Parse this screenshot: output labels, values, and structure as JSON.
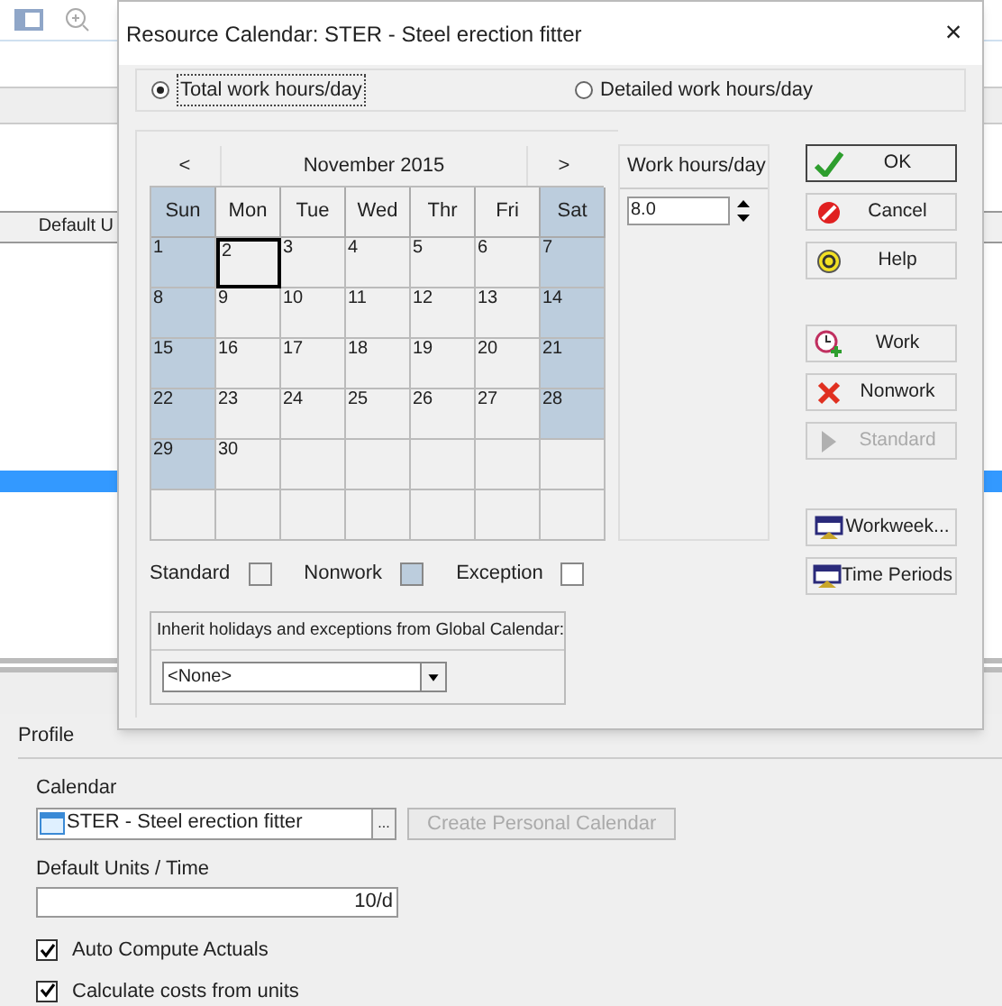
{
  "background": {
    "column_header": "Default U",
    "profile": {
      "title": "Profile",
      "calendar_label": "Calendar",
      "calendar_value": "STER - Steel erection fitter",
      "browse_button": "...",
      "create_button": {
        "label": "Create Personal Calendar",
        "disabled": true
      },
      "units_label": "Default Units / Time",
      "units_value": "10/d",
      "checkboxes": [
        {
          "label": "Auto Compute Actuals",
          "checked": true
        },
        {
          "label": "Calculate costs from units",
          "checked": true
        }
      ]
    }
  },
  "dialog": {
    "title": "Resource Calendar: STER - Steel erection fitter",
    "close": "×",
    "modes": [
      {
        "label": "Total work hours/day",
        "selected": true
      },
      {
        "label": "Detailed work hours/day",
        "selected": false
      }
    ],
    "calendar": {
      "prev": "<",
      "month": "November 2015",
      "next": ">",
      "weekdays": [
        {
          "label": "Sun",
          "nonwork": true
        },
        {
          "label": "Mon",
          "nonwork": false
        },
        {
          "label": "Tue",
          "nonwork": false
        },
        {
          "label": "Wed",
          "nonwork": false
        },
        {
          "label": "Thr",
          "nonwork": false
        },
        {
          "label": "Fri",
          "nonwork": false
        },
        {
          "label": "Sat",
          "nonwork": true
        }
      ],
      "weeks": [
        [
          {
            "day": "1",
            "nonwork": true,
            "selected": false
          },
          {
            "day": "2",
            "nonwork": false,
            "selected": true
          },
          {
            "day": "3",
            "nonwork": false,
            "selected": false
          },
          {
            "day": "4",
            "nonwork": false,
            "selected": false
          },
          {
            "day": "5",
            "nonwork": false,
            "selected": false
          },
          {
            "day": "6",
            "nonwork": false,
            "selected": false
          },
          {
            "day": "7",
            "nonwork": true,
            "selected": false
          }
        ],
        [
          {
            "day": "8",
            "nonwork": true,
            "selected": false
          },
          {
            "day": "9",
            "nonwork": false,
            "selected": false
          },
          {
            "day": "10",
            "nonwork": false,
            "selected": false
          },
          {
            "day": "11",
            "nonwork": false,
            "selected": false
          },
          {
            "day": "12",
            "nonwork": false,
            "selected": false
          },
          {
            "day": "13",
            "nonwork": false,
            "selected": false
          },
          {
            "day": "14",
            "nonwork": true,
            "selected": false
          }
        ],
        [
          {
            "day": "15",
            "nonwork": true,
            "selected": false
          },
          {
            "day": "16",
            "nonwork": false,
            "selected": false
          },
          {
            "day": "17",
            "nonwork": false,
            "selected": false
          },
          {
            "day": "18",
            "nonwork": false,
            "selected": false
          },
          {
            "day": "19",
            "nonwork": false,
            "selected": false
          },
          {
            "day": "20",
            "nonwork": false,
            "selected": false
          },
          {
            "day": "21",
            "nonwork": true,
            "selected": false
          }
        ],
        [
          {
            "day": "22",
            "nonwork": true,
            "selected": false
          },
          {
            "day": "23",
            "nonwork": false,
            "selected": false
          },
          {
            "day": "24",
            "nonwork": false,
            "selected": false
          },
          {
            "day": "25",
            "nonwork": false,
            "selected": false
          },
          {
            "day": "26",
            "nonwork": false,
            "selected": false
          },
          {
            "day": "27",
            "nonwork": false,
            "selected": false
          },
          {
            "day": "28",
            "nonwork": true,
            "selected": false
          }
        ],
        [
          {
            "day": "29",
            "nonwork": true,
            "selected": false
          },
          {
            "day": "30",
            "nonwork": false,
            "selected": false
          },
          {
            "nonwork": false,
            "selected": false
          },
          {
            "nonwork": false,
            "selected": false
          },
          {
            "nonwork": false,
            "selected": false
          },
          {
            "nonwork": false,
            "selected": false
          },
          {
            "nonwork": false,
            "selected": false
          }
        ],
        [
          {
            "nonwork": false,
            "selected": false
          },
          {
            "nonwork": false,
            "selected": false
          },
          {
            "nonwork": false,
            "selected": false
          },
          {
            "nonwork": false,
            "selected": false
          },
          {
            "nonwork": false,
            "selected": false
          },
          {
            "nonwork": false,
            "selected": false
          },
          {
            "nonwork": false,
            "selected": false
          }
        ]
      ],
      "legend": [
        {
          "label": "Standard",
          "kind": "standard"
        },
        {
          "label": "Nonwork",
          "kind": "nonwork"
        },
        {
          "label": "Exception",
          "kind": "exception"
        }
      ],
      "inherit_label": "Inherit holidays and exceptions from Global Calendar:",
      "inherit_value": "<None>"
    },
    "hours": {
      "title": "Work hours/day",
      "value": "8.0"
    },
    "buttons": [
      {
        "label": "OK",
        "kind": "ok",
        "disabled": false
      },
      {
        "label": "Cancel",
        "kind": "cancel",
        "disabled": false
      },
      {
        "label": "Help",
        "kind": "help",
        "disabled": false
      },
      {
        "label": "Work",
        "kind": "work",
        "disabled": false
      },
      {
        "label": "Nonwork",
        "kind": "nonwork",
        "disabled": false
      },
      {
        "label": "Standard",
        "kind": "standard",
        "disabled": true
      },
      {
        "label": "Workweek...",
        "kind": "workweek",
        "disabled": false
      },
      {
        "label": "Time Periods",
        "kind": "periods",
        "disabled": false
      }
    ]
  }
}
